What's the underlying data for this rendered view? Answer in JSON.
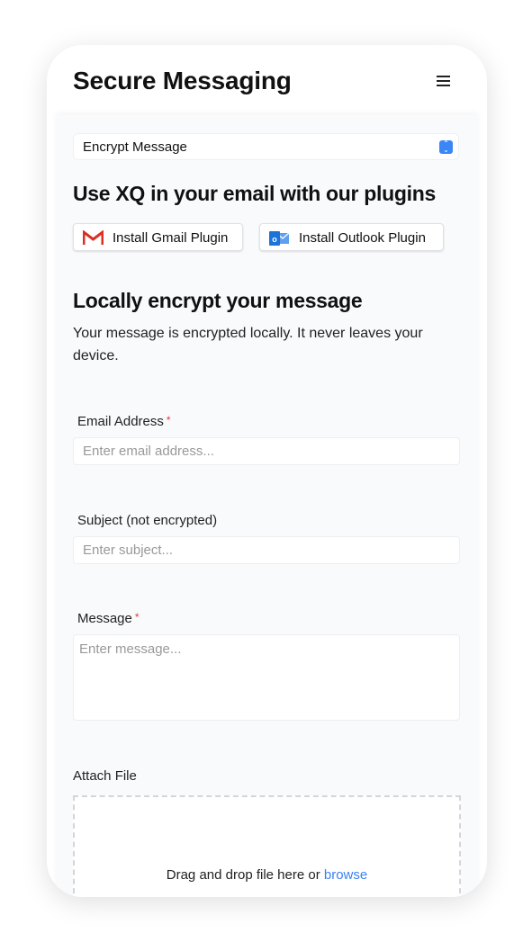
{
  "header": {
    "title": "Secure Messaging",
    "menu_icon": "hamburger-menu-icon"
  },
  "mode_select": {
    "value": "Encrypt Message"
  },
  "plugins": {
    "heading": "Use XQ in your email with our plugins",
    "gmail_label": "Install Gmail Plugin",
    "outlook_label": "Install Outlook Plugin"
  },
  "encrypt": {
    "heading": "Locally encrypt your message",
    "description": "Your message is encrypted locally. It never leaves your device."
  },
  "form": {
    "email": {
      "label": "Email Address",
      "required": "*",
      "placeholder": "Enter email address..."
    },
    "subject": {
      "label": "Subject (not encrypted)",
      "placeholder": "Enter subject..."
    },
    "message": {
      "label": "Message",
      "required": "*",
      "placeholder": "Enter message..."
    },
    "attach": {
      "label": "Attach File",
      "drop_text": "Drag and drop file here or ",
      "browse": "browse"
    }
  },
  "colors": {
    "accent": "#3b82f0",
    "required": "#e23b3b",
    "gmail_red": "#d93025",
    "outlook_blue": "#1e73d8"
  }
}
